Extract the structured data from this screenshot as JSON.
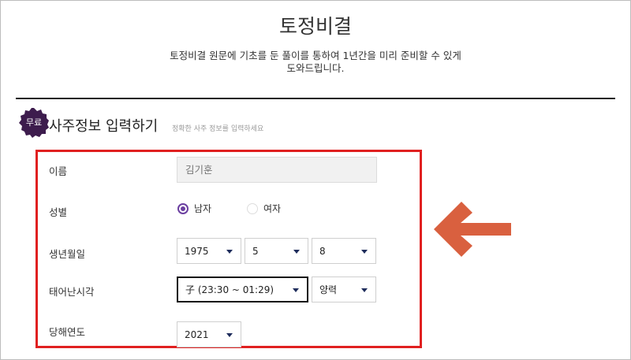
{
  "header": {
    "title": "토정비결",
    "description_line1": "토정비결 원문에 기초를 둔 풀이를 통하여 1년간을 미리 준비할 수 있게",
    "description_line2": "도와드립니다."
  },
  "section": {
    "badge": "무료",
    "title": "사주정보 입력하기",
    "subtitle": "정확한 사주 정보를 입력하세요"
  },
  "form": {
    "name_label": "이름",
    "name_placeholder": "김기훈",
    "gender_label": "성별",
    "gender_options": [
      "남자",
      "여자"
    ],
    "gender_selected": "남자",
    "birth_label": "생년월일",
    "birth_year": "1975",
    "birth_month": "5",
    "birth_day": "8",
    "time_label": "태어난시각",
    "birth_time": "子 (23:30 ~ 01:29)",
    "calendar": "양력",
    "year_label": "당해연도",
    "current_year": "2021"
  },
  "colors": {
    "accent_purple": "#6b3fa0",
    "badge_bg": "#3d1c4d",
    "highlight_border": "#e02020",
    "arrow": "#d9603f",
    "caret": "#1f2d5c"
  },
  "icons": {
    "badge_shape": "scalloped-badge",
    "caret": "caret-down-icon",
    "arrow": "left-arrow-icon"
  }
}
